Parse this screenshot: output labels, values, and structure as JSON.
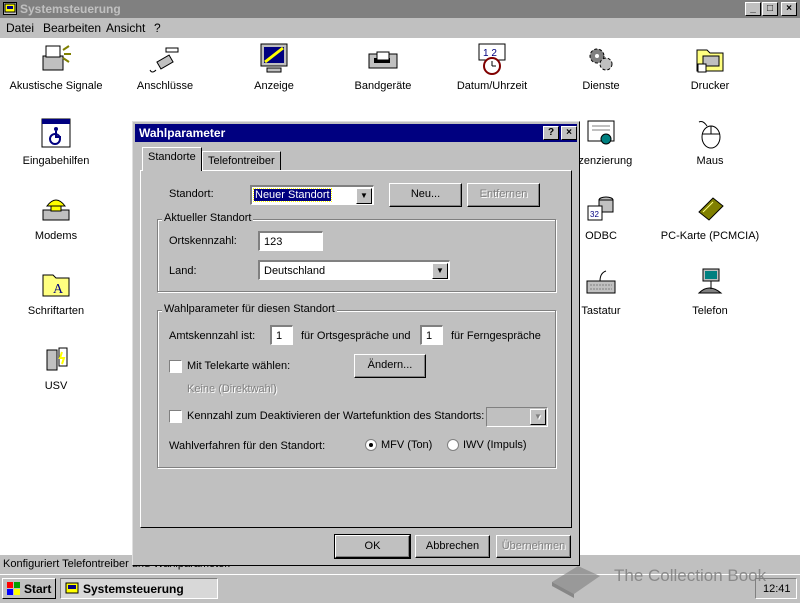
{
  "window": {
    "title": "Systemsteuerung",
    "controls": {
      "minimize": "_",
      "maximize": "□",
      "close": "×"
    }
  },
  "menubar": {
    "items": [
      "Datei",
      "Bearbeiten",
      "Ansicht",
      "?"
    ]
  },
  "control_panel_items": [
    {
      "label": "Akustische Signale",
      "icon": "speaker-icon"
    },
    {
      "label": "Anschlüsse",
      "icon": "plug-icon"
    },
    {
      "label": "Anzeige",
      "icon": "display-icon"
    },
    {
      "label": "Bandgeräte",
      "icon": "tape-drive-icon"
    },
    {
      "label": "Datum/Uhrzeit",
      "icon": "calendar-clock-icon"
    },
    {
      "label": "Dienste",
      "icon": "gears-icon"
    },
    {
      "label": "Drucker",
      "icon": "printer-folder-icon"
    },
    {
      "label": "Eingabehilfen",
      "icon": "accessibility-icon"
    },
    {
      "label": "Lizenzierung",
      "icon": "certificate-icon"
    },
    {
      "label": "Maus",
      "icon": "mouse-icon"
    },
    {
      "label": "Modems",
      "icon": "modem-phone-icon"
    },
    {
      "label": "ODBC",
      "icon": "odbc-icon"
    },
    {
      "label": "PC-Karte (PCMCIA)",
      "icon": "pc-card-icon"
    },
    {
      "label": "Schriftarten",
      "icon": "fonts-folder-icon"
    },
    {
      "label": "Tastatur",
      "icon": "keyboard-icon"
    },
    {
      "label": "Telefon",
      "icon": "telephone-network-icon"
    },
    {
      "label": "USV",
      "icon": "ups-battery-icon"
    }
  ],
  "dialog": {
    "title": "Wahlparameter",
    "help_button": "?",
    "close_button": "×",
    "tabs": [
      "Standorte",
      "Telefontreiber"
    ],
    "active_tab": "Standorte",
    "standort": {
      "label": "Standort:",
      "value": "Neuer Standort",
      "new_button": "Neu...",
      "remove_button": "Entfernen"
    },
    "aktueller_standort": {
      "group_title": "Aktueller Standort",
      "ortskennzahl_label": "Ortskennzahl:",
      "ortskennzahl_value": "123",
      "land_label": "Land:",
      "land_value": "Deutschland"
    },
    "wahlparameter_group": {
      "group_title": "Wahlparameter für diesen Standort",
      "amtskennzahl_label": "Amtskennzahl ist:",
      "ortsgespraeche_value": "1",
      "ortsgespraeche_label": "für Ortsgespräche und",
      "ferngespraeche_value": "1",
      "ferngespraeche_label": "für Ferngespräche",
      "telekarte_label": "Mit Telekarte wählen:",
      "telekarte_checked": false,
      "aendern_button": "Ändern...",
      "telekarte_info": "Keine (Direktwahl)",
      "kennzahl_label": "Kennzahl zum Deaktivieren der Wartefunktion des Standorts:",
      "kennzahl_checked": false,
      "wahlverfahren_label": "Wahlverfahren für den Standort:",
      "mfv_label": "MFV (Ton)",
      "iwv_label": "IWV (Impuls)",
      "selected_mode": "MFV (Ton)"
    },
    "buttons": {
      "ok": "OK",
      "cancel": "Abbrechen",
      "apply": "Übernehmen"
    }
  },
  "statusbar": {
    "text": "Konfiguriert Telefontreiber und Wahlparameter."
  },
  "taskbar": {
    "start_label": "Start",
    "task_label": "Systemsteuerung",
    "clock": "12:41"
  },
  "watermark": "The Collection Book",
  "colors": {
    "desktop_gray": "#c0c0c0",
    "active_title": "#000080",
    "inactive_title": "#808080"
  }
}
